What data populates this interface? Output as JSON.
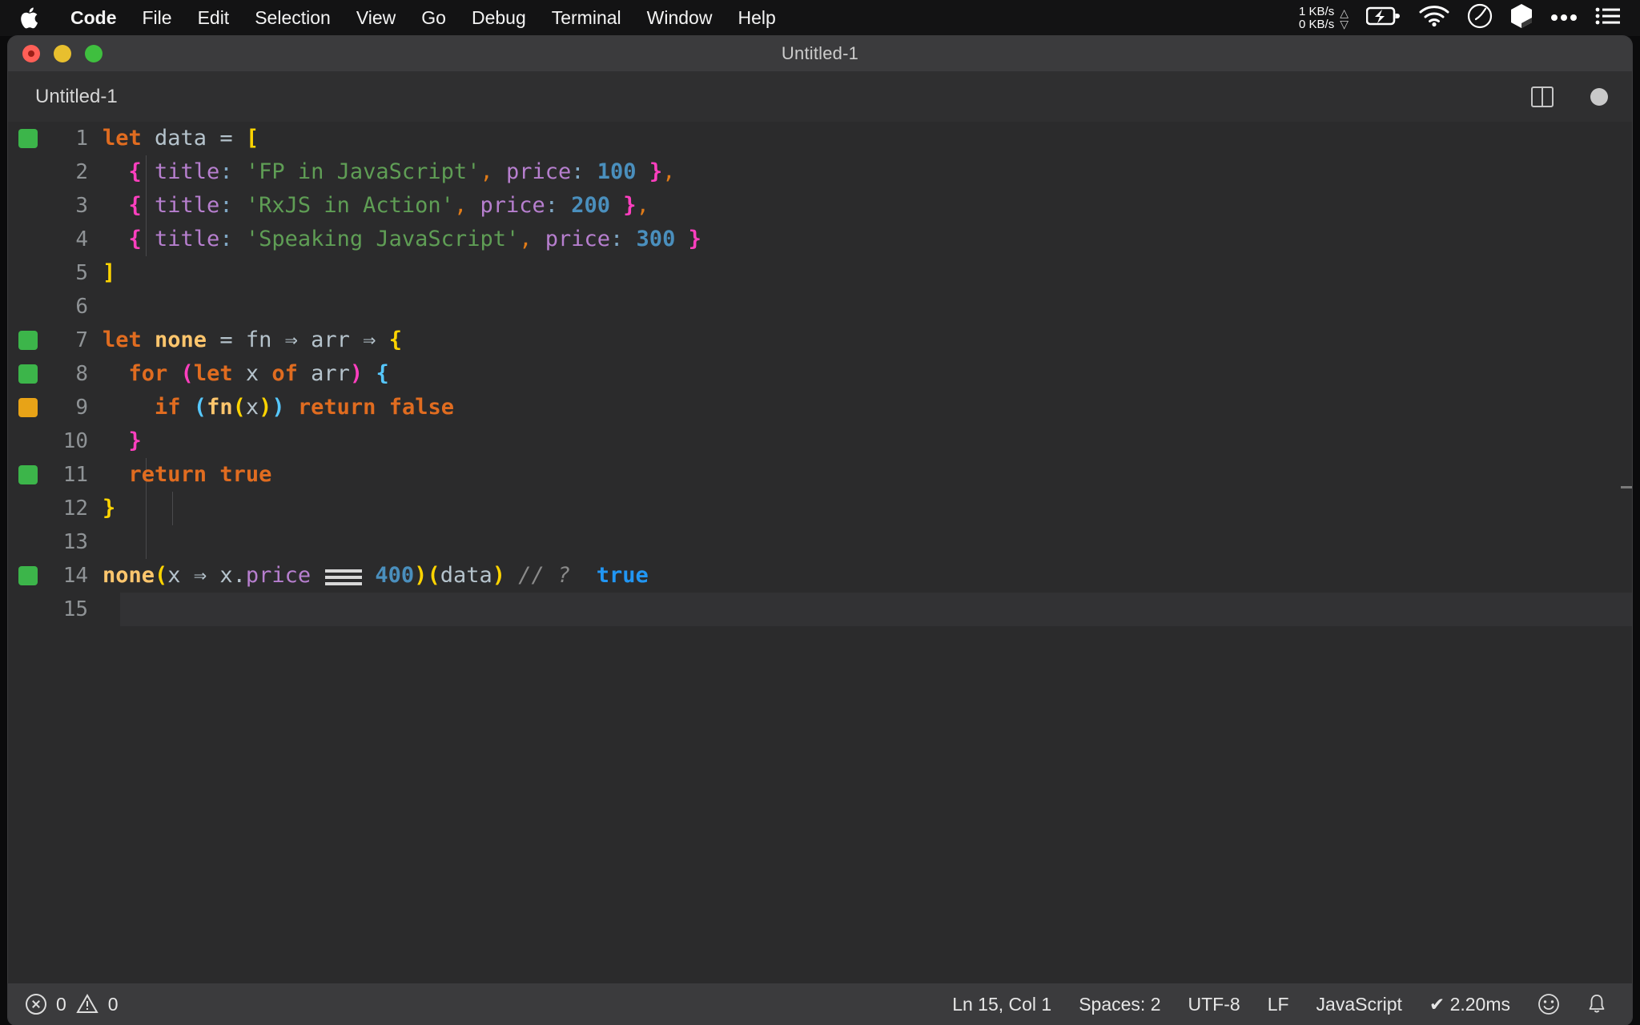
{
  "menubar": {
    "apple_icon": "apple-logo",
    "items": [
      "Code",
      "File",
      "Edit",
      "Selection",
      "View",
      "Go",
      "Debug",
      "Terminal",
      "Window",
      "Help"
    ],
    "status": {
      "net_up": "1 KB/s",
      "net_down": "0 KB/s",
      "up_arrow": "△",
      "down_arrow": "▽",
      "icons": [
        "battery-charging-icon",
        "wifi-icon",
        "gauge-icon",
        "cube-icon",
        "ellipsis-icon",
        "list-icon"
      ]
    }
  },
  "window": {
    "title": "Untitled-1",
    "traffic_lights": [
      "close",
      "minimize",
      "zoom"
    ]
  },
  "tabbar": {
    "tabs": [
      {
        "label": "Untitled-1",
        "active": true,
        "dirty": true
      }
    ],
    "actions": [
      "split-editor-icon",
      "unsaved-dot-icon"
    ]
  },
  "editor": {
    "active_line": 15,
    "lines": [
      {
        "n": "1",
        "marker": "green"
      },
      {
        "n": "2",
        "marker": ""
      },
      {
        "n": "3",
        "marker": ""
      },
      {
        "n": "4",
        "marker": ""
      },
      {
        "n": "5",
        "marker": ""
      },
      {
        "n": "6",
        "marker": ""
      },
      {
        "n": "7",
        "marker": "green"
      },
      {
        "n": "8",
        "marker": "green"
      },
      {
        "n": "9",
        "marker": "orange"
      },
      {
        "n": "10",
        "marker": ""
      },
      {
        "n": "11",
        "marker": "green"
      },
      {
        "n": "12",
        "marker": ""
      },
      {
        "n": "13",
        "marker": ""
      },
      {
        "n": "14",
        "marker": "green"
      },
      {
        "n": "15",
        "marker": ""
      }
    ],
    "code": {
      "l1_let": "let",
      "l1_data": " data ",
      "l1_eq": "= ",
      "l1_brk": "[",
      "l2_brace": "  {",
      "l2_title": " title",
      "l2_colon": ":",
      "l2_str": " 'FP in JavaScript'",
      "l2_comma": ",",
      "l2_price": " price",
      "l2_colon2": ":",
      "l2_num": " 100 ",
      "l2_brace2": "}",
      "l2_comma2": ",",
      "l3_brace": "  {",
      "l3_title": " title",
      "l3_colon": ":",
      "l3_str": " 'RxJS in Action'",
      "l3_comma": ",",
      "l3_price": " price",
      "l3_colon2": ":",
      "l3_num": " 200 ",
      "l3_brace2": "}",
      "l3_comma2": ",",
      "l4_brace": "  {",
      "l4_title": " title",
      "l4_colon": ":",
      "l4_str": " 'Speaking JavaScript'",
      "l4_comma": ",",
      "l4_price": " price",
      "l4_colon2": ":",
      "l4_num": " 300 ",
      "l4_brace2": "}",
      "l5_brk": "]",
      "l7_let": "let",
      "l7_none": " none ",
      "l7_eq": "= ",
      "l7_fn": "fn ",
      "l7_arrow": "⇒",
      "l7_arr": " arr ",
      "l7_arrow2": "⇒",
      "l7_brace": " {",
      "l8_for": "  for ",
      "l8_paren": "(",
      "l8_let": "let",
      "l8_x": " x ",
      "l8_of": "of",
      "l8_arr": " arr",
      "l8_paren2": ")",
      "l8_brace": " {",
      "l9_if": "    if ",
      "l9_paren": "(",
      "l9_fn": "fn",
      "l9_paren2": "(",
      "l9_x": "x",
      "l9_paren3": ")",
      "l9_paren4": ")",
      "l9_return": " return ",
      "l9_false": "false",
      "l10_brace": "  }",
      "l11_return": "  return ",
      "l11_true": "true",
      "l12_brace": "}",
      "l14_none": "none",
      "l14_paren": "(",
      "l14_x": "x ",
      "l14_arrow": "⇒",
      "l14_xprice_x": " x.",
      "l14_price": "price",
      "l14_eq3_glyph": "≡",
      "l14_num": " 400",
      "l14_paren2": ")",
      "l14_paren3": "(",
      "l14_data": "data",
      "l14_paren4": ")",
      "l14_comment": " // ?",
      "l14_result": "  true"
    }
  },
  "statusbar": {
    "errors": "0",
    "warnings": "0",
    "error_icon": "error-circle-icon",
    "warning_icon": "warning-triangle-icon",
    "position": "Ln 15, Col 1",
    "indentation": "Spaces: 2",
    "encoding": "UTF-8",
    "eol": "LF",
    "language": "JavaScript",
    "runtime": "✔ 2.20ms",
    "feedback_icon": "smiley-icon",
    "bell_icon": "bell-icon"
  },
  "colors": {
    "accent_green": "#3cb54a",
    "accent_orange": "#e8a317",
    "result_blue": "#2196f3",
    "editor_bg": "#2b2b2c",
    "chrome_bg": "#3b3b3d"
  }
}
